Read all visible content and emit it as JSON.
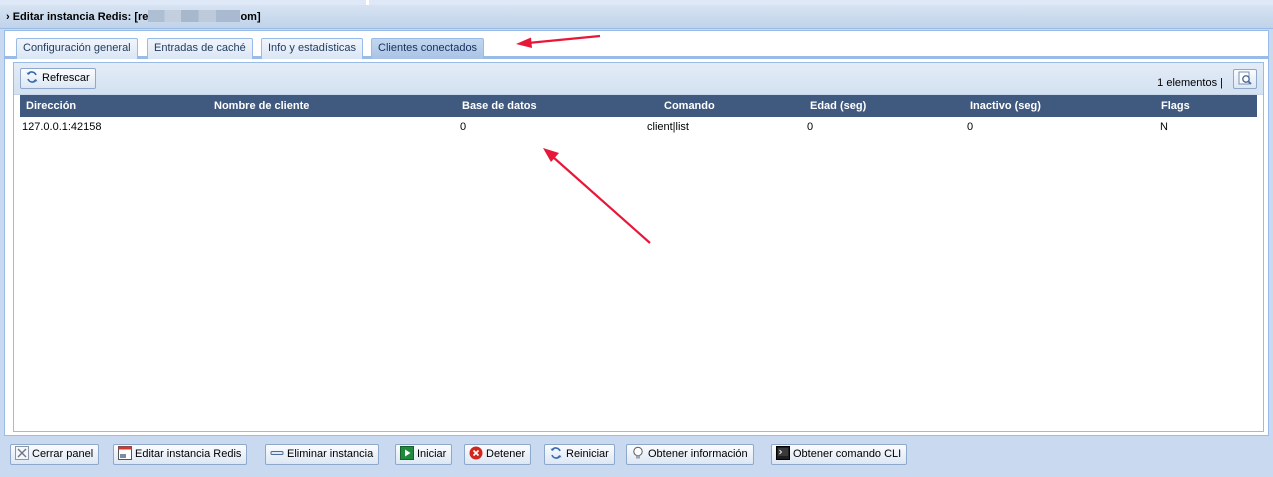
{
  "panel": {
    "title_prefix": "› Editar instancia Redis: [re",
    "title_suffix": "om]"
  },
  "tabs": [
    {
      "label": "Configuración general",
      "active": false
    },
    {
      "label": "Entradas de caché",
      "active": false
    },
    {
      "label": "Info y estadísticas",
      "active": false
    },
    {
      "label": "Clientes conectados",
      "active": true
    }
  ],
  "toolbar": {
    "refresh_label": "Refrescar",
    "count_text": "1 elementos |"
  },
  "grid": {
    "columns": [
      "Dirección",
      "Nombre de cliente",
      "Base de datos",
      "Comando",
      "Edad (seg)",
      "Inactivo (seg)",
      "Flags"
    ],
    "rows": [
      [
        "127.0.0.1:42158",
        "",
        "0",
        "client|list",
        "0",
        "0",
        "N"
      ]
    ]
  },
  "actions": {
    "close": "Cerrar panel",
    "edit": "Editar instancia Redis",
    "delete": "Eliminar instancia",
    "start": "Iniciar",
    "stop": "Detener",
    "restart": "Reiniciar",
    "info": "Obtener información",
    "cli": "Obtener comando CLI"
  },
  "colors": {
    "header_bg": "#405a7f",
    "annotation_arrow": "#e8173a",
    "panel_border": "#99bbe8"
  }
}
